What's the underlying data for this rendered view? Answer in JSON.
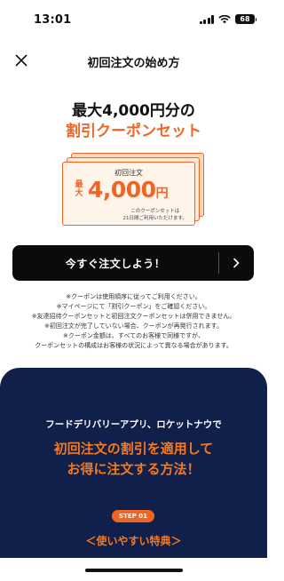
{
  "status_bar": {
    "time": "13:01",
    "battery": "68"
  },
  "nav": {
    "title": "初回注文の始め方",
    "close_icon": "close-icon"
  },
  "hero": {
    "line1": "最大4,000円分の",
    "line2": "割引クーポンセット"
  },
  "coupon": {
    "label": "初回注文",
    "prefix": "最大",
    "amount": "4,000",
    "currency": "円",
    "note_line1": "このクーポンセットは",
    "note_line2": "21日間ご利用いただけます。"
  },
  "cta": {
    "label": "今すぐ注文しよう！",
    "chevron_icon": "chevron-right-icon"
  },
  "notes": [
    "※クーポンは使用順序に従ってご利用ください。",
    "※マイページにて「割引クーポン」をご確認ください。",
    "※友達招待クーポンセットと初回注文クーポンセットは併用できません。",
    "※初回注文が完了していない場合、クーポンが再発行されます。",
    "※クーポン金額は、すべてのお客様で同様ですが、",
    "クーポンセットの構成はお客様の状況によって異なる場合があります。"
  ],
  "section": {
    "subtitle": "フードデリバリーアプリ、ロケットナウで",
    "title_line1": "初回注文の割引を適用して",
    "title_line2": "お得に注文する方法！",
    "step_badge": "STEP 01",
    "step_title": "＜使いやすい特典＞"
  },
  "colors": {
    "accent": "#f06524",
    "dark_bg": "#10204a",
    "cta_bg": "#0b0b0b"
  }
}
